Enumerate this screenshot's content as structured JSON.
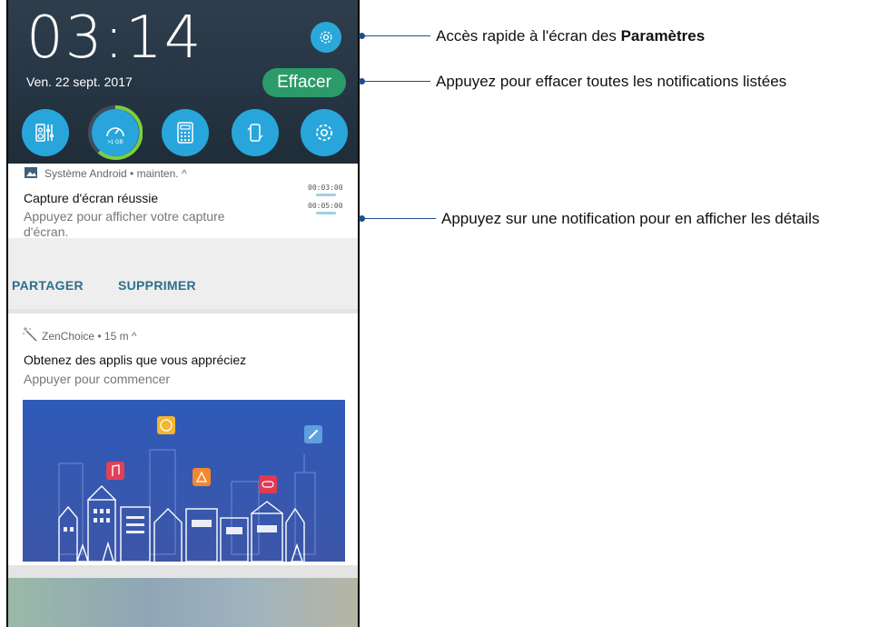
{
  "status": {
    "time": "03:14",
    "date": "Ven. 22 sept. 2017"
  },
  "header": {
    "clear_button": "Effacer",
    "data_badge": ">1 GB"
  },
  "notification1": {
    "app": "Système Android • mainten. ^",
    "title": "Capture d'écran réussie",
    "text": "Appuyez pour afficher votre capture d'écran.",
    "thumb_time1": "00:03:00",
    "thumb_time2": "00:05:00",
    "action1": "PARTAGER",
    "action2": "SUPPRIMER"
  },
  "notification2": {
    "app": "ZenChoice • 15 m ^",
    "title": "Obtenez des applis que vous appréciez",
    "text": "Appuyer pour commencer"
  },
  "annotations": {
    "settings_prefix": "Accès rapide à l'écran des ",
    "settings_bold": "Paramètres",
    "clear": "Appuyez pour effacer toutes les notifications listées",
    "details": "Appuyez sur une notification pour en afficher les détails"
  },
  "colors": {
    "accent_blue": "#28a6dc",
    "clear_green": "#2b9b6a",
    "callout_line": "#1a4f8a"
  }
}
